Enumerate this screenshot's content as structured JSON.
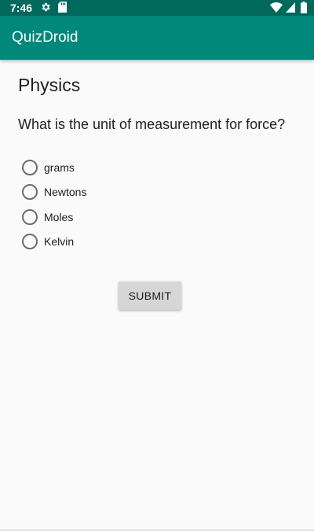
{
  "status_bar": {
    "time": "7:46",
    "icons": [
      "gear-icon",
      "sd-card-icon",
      "wifi-icon",
      "signal-icon",
      "battery-icon"
    ],
    "color": "#00695c"
  },
  "app_bar": {
    "title": "QuizDroid",
    "color": "#00897b"
  },
  "quiz": {
    "subject": "Physics",
    "question": "What is the unit of measurement for force?",
    "options": [
      {
        "label": "grams",
        "selected": false
      },
      {
        "label": "Newtons",
        "selected": false
      },
      {
        "label": "Moles",
        "selected": false
      },
      {
        "label": "Kelvin",
        "selected": false
      }
    ],
    "submit_label": "SUBMIT"
  }
}
